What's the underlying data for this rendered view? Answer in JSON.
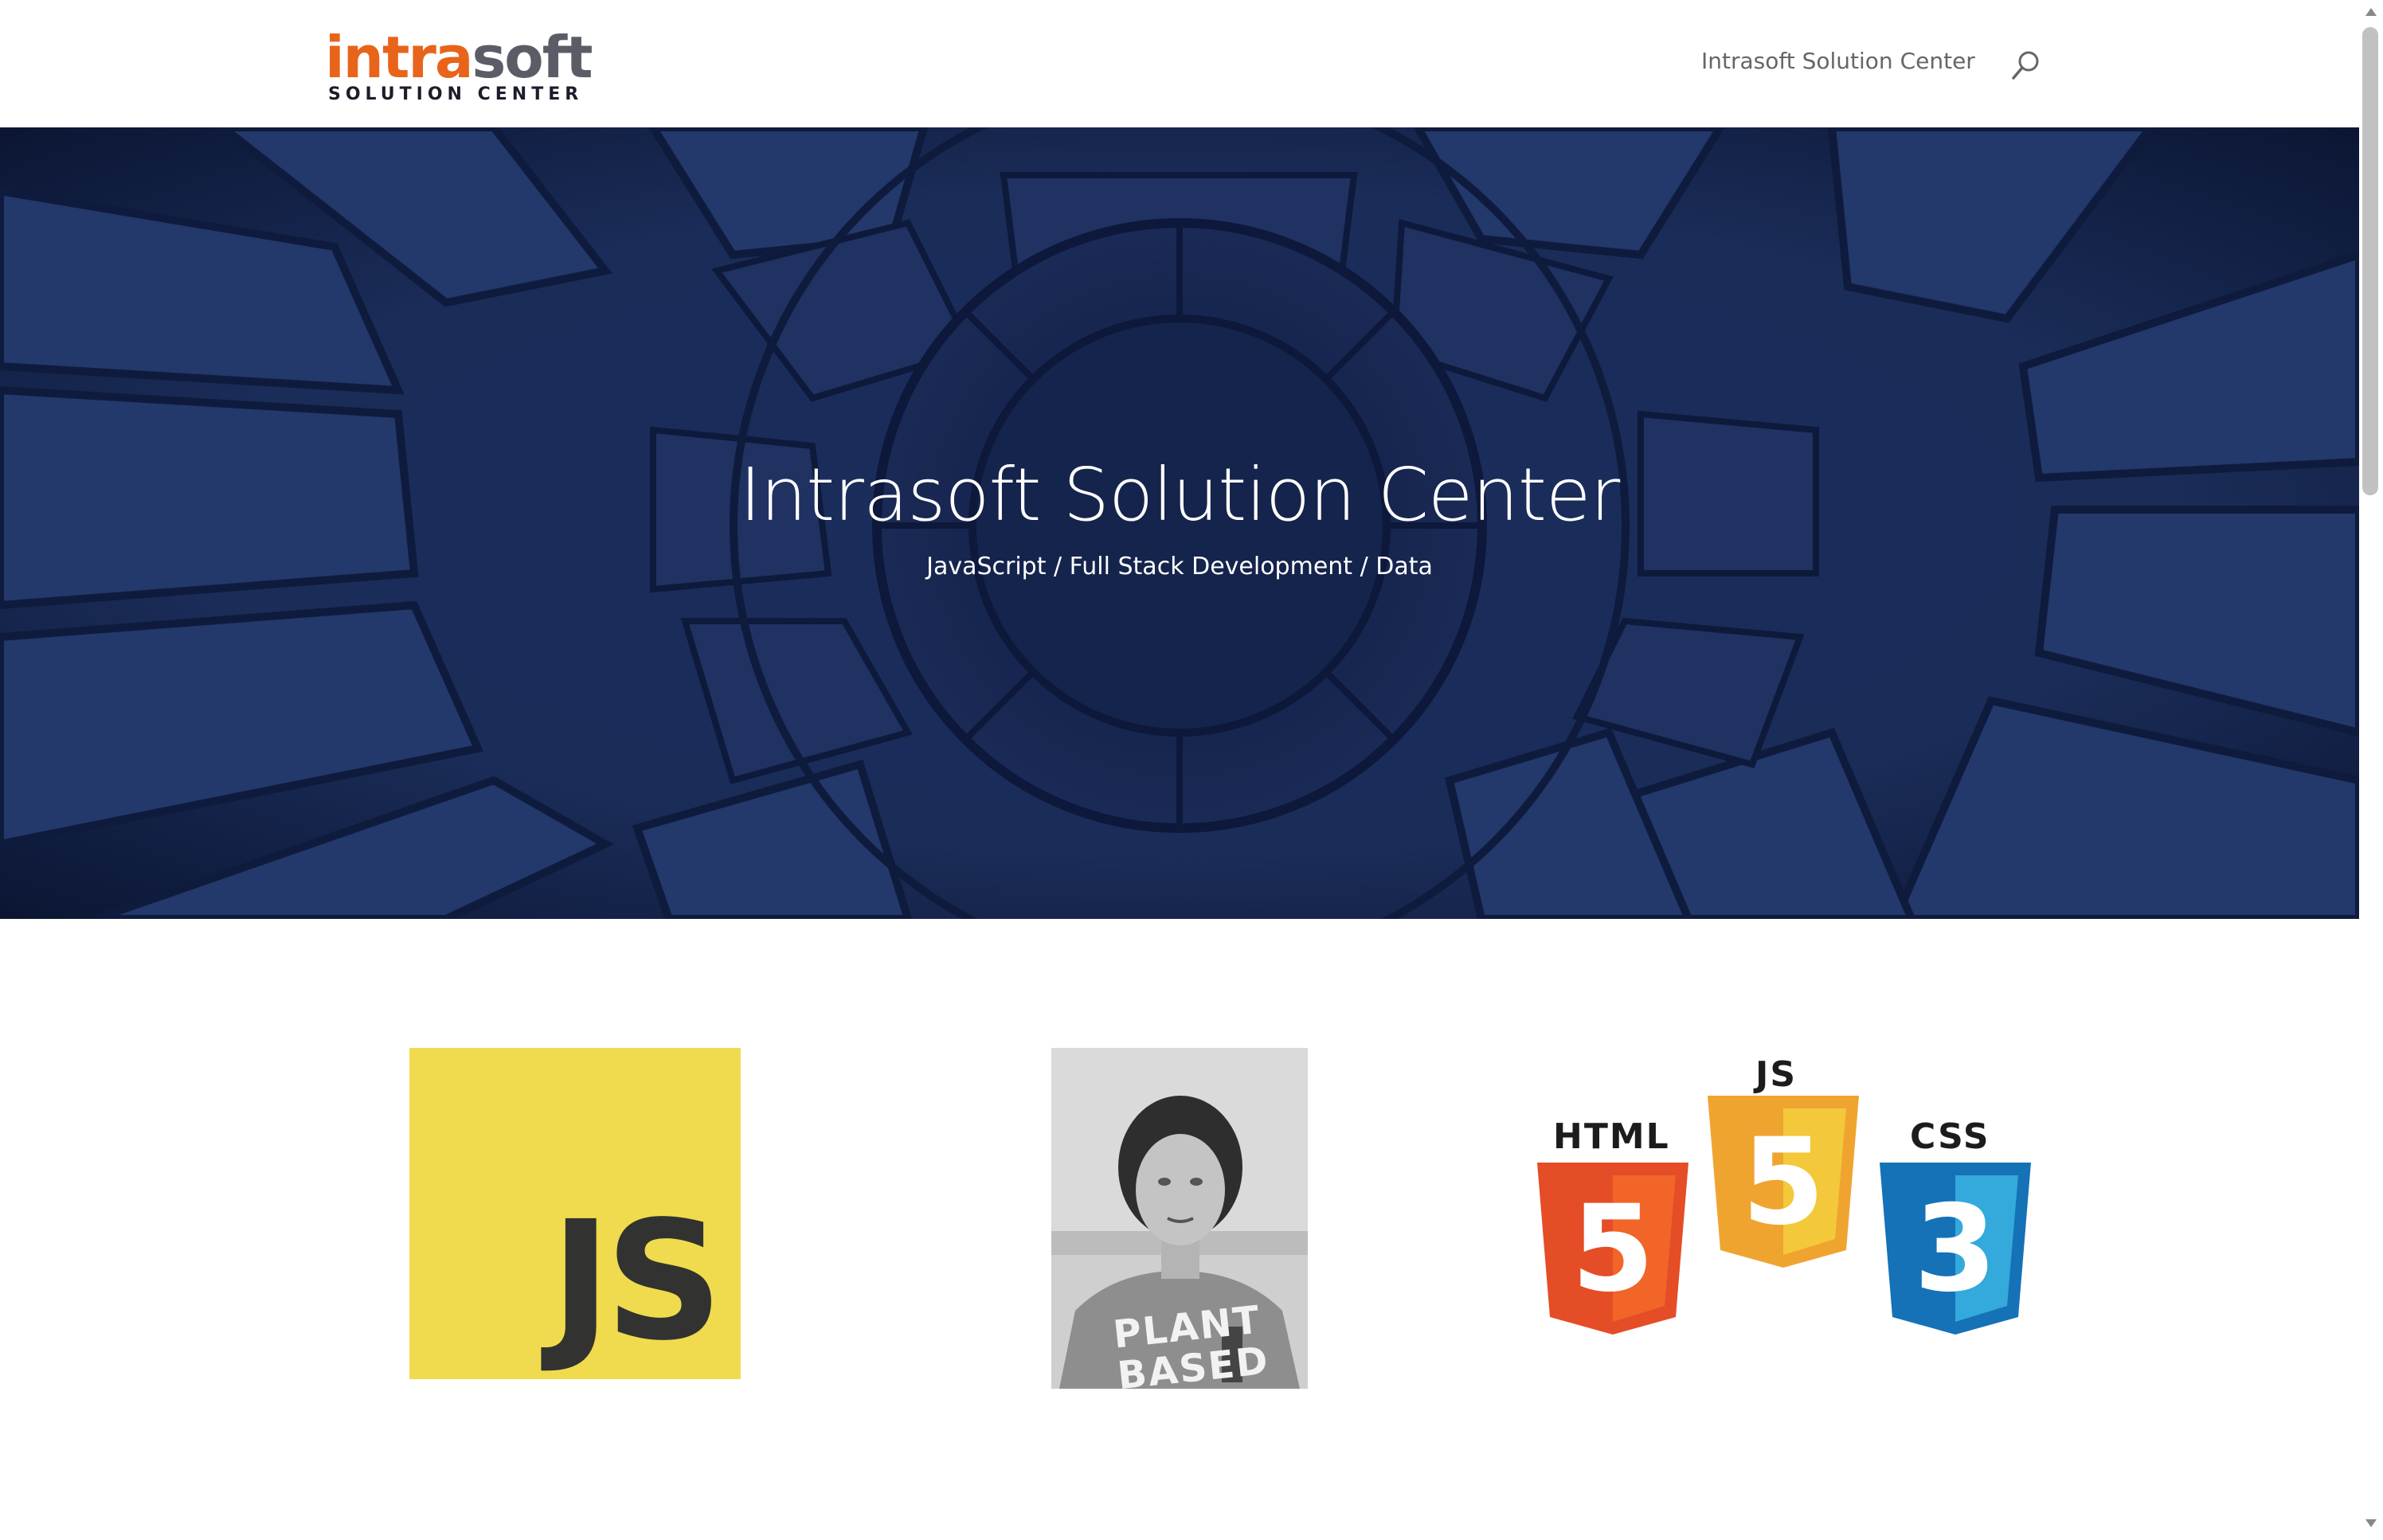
{
  "header": {
    "logo": {
      "primary_orange": "intra",
      "primary_gray": "soft",
      "subtitle": "SOLUTION CENTER"
    },
    "nav": {
      "link_label": "Intrasoft Solution Center"
    },
    "icons": {
      "search": "search-icon"
    }
  },
  "hero": {
    "title": "Intrasoft Solution Center",
    "subtitle": "JavaScript / Full Stack Development / Data"
  },
  "tiles": {
    "js_logo": {
      "text": "JS"
    },
    "photo": {
      "caption": "PLANT BASED"
    },
    "tech": {
      "html_label": "HTML",
      "js_label": "JS",
      "css_label": "CSS",
      "html_digit": "5",
      "js_digit": "5",
      "css_digit": "3"
    }
  },
  "colors": {
    "brand_orange": "#e8641b",
    "brand_gray": "#5b5d66",
    "hero_bg": "#16264f",
    "js_yellow": "#f0db4f",
    "html_orange": "#e44d26",
    "js_shield": "#f0a430",
    "css_blue": "#1572b6"
  }
}
